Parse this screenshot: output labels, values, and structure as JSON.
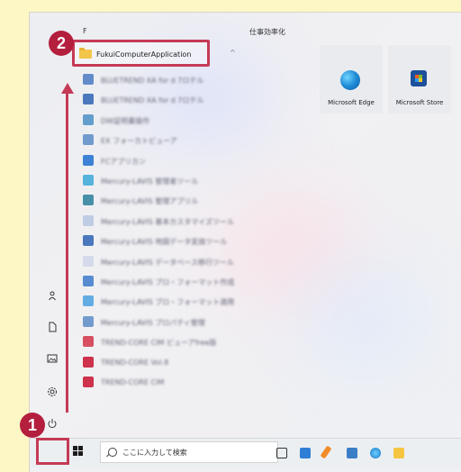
{
  "start_menu": {
    "letter_header": "F",
    "pinned_section_title": "仕事効率化",
    "highlighted_folder": "FukuiComputerApplication",
    "app_list": [
      {
        "label": "BLUETREND XA for d 7ロテル",
        "icon_color": "#4a7ac2"
      },
      {
        "label": "BLUETREND XA for d 7ロテル",
        "icon_color": "#2e63b3"
      },
      {
        "label": "DW証明書操作",
        "icon_color": "#4a8fc7"
      },
      {
        "label": "EX フォーカトビューア",
        "icon_color": "#5b8cc6"
      },
      {
        "label": "FCアプリカン",
        "icon_color": "#1f6fd1"
      },
      {
        "label": "Mercury-LAVIS 管理者ツール",
        "icon_color": "#3aa8d8"
      },
      {
        "label": "Mercury-LAVIS 管理アプリル",
        "icon_color": "#2a7f9a"
      },
      {
        "label": "Mercury-LAVIS 基本カスタマイズツール",
        "icon_color": "#b7c6e2"
      },
      {
        "label": "Mercury-LAVIS 地図データ変換ツール",
        "icon_color": "#2e63b3"
      },
      {
        "label": "Mercury-LAVIS データベース移行ツール",
        "icon_color": "#cfd6e6"
      },
      {
        "label": "Mercury-LAVIS プロ・フォーマット作成",
        "icon_color": "#3d79c9"
      },
      {
        "label": "Mercury-LAVIS プロ・フォーマット適用",
        "icon_color": "#4aa0e0"
      },
      {
        "label": "Mercury-LAVIS プロパティ管理",
        "icon_color": "#5b8cc6"
      },
      {
        "label": "TREND-CORE CIM ビューアfree版",
        "icon_color": "#d23345"
      },
      {
        "label": "TREND-CORE Vol.8",
        "icon_color": "#c8102e"
      },
      {
        "label": "TREND-CORE CIM",
        "icon_color": "#c8102e"
      }
    ],
    "tiles": [
      {
        "label": "Microsoft Edge",
        "icon": "edge-icon"
      },
      {
        "label": "Microsoft Store",
        "icon": "store-icon"
      }
    ],
    "rail_icons": [
      "user-icon",
      "document-icon",
      "pictures-icon",
      "settings-icon",
      "power-icon"
    ]
  },
  "callouts": {
    "step1": "1",
    "step2": "2",
    "accent_color": "#c53a55"
  },
  "taskbar": {
    "search_placeholder": "ここに入力して検索",
    "icons": [
      "start-icon",
      "task-view-icon",
      "app-icon-1",
      "app-icon-2",
      "app-icon-3",
      "edge-icon",
      "file-explorer-icon"
    ]
  }
}
